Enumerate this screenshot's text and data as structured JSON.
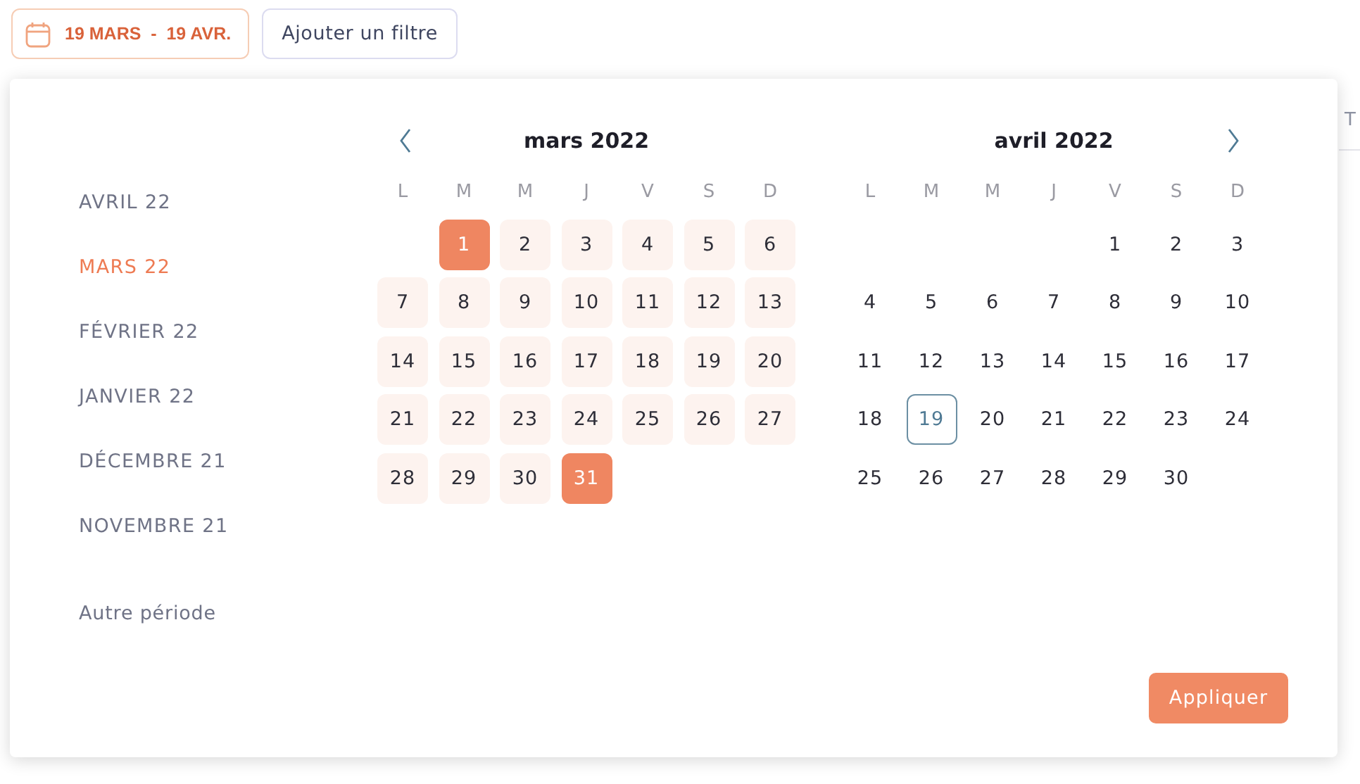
{
  "date_button": {
    "label": "19 MARS  -  19 AVR."
  },
  "filter_button": {
    "label": "Ajouter un filtre"
  },
  "background_text": "T",
  "sidebar": {
    "items": [
      {
        "label": "AVRIL 22",
        "selected": false
      },
      {
        "label": "MARS 22",
        "selected": true
      },
      {
        "label": "FÉVRIER 22",
        "selected": false
      },
      {
        "label": "JANVIER 22",
        "selected": false
      },
      {
        "label": "DÉCEMBRE 21",
        "selected": false
      },
      {
        "label": "NOVEMBRE 21",
        "selected": false
      }
    ],
    "other": "Autre période"
  },
  "calendars": [
    {
      "title": "mars 2022",
      "weekdays": [
        "L",
        "M",
        "M",
        "J",
        "V",
        "S",
        "D"
      ],
      "weeks": [
        [
          {
            "kind": "blank"
          },
          {
            "kind": "day",
            "label": "1",
            "selected": true,
            "today": false
          },
          {
            "kind": "day",
            "label": "2",
            "selected": false,
            "in_range": true,
            "today": false
          },
          {
            "kind": "day",
            "label": "3",
            "selected": false,
            "in_range": true,
            "today": false
          },
          {
            "kind": "day",
            "label": "4",
            "selected": false,
            "in_range": true,
            "today": false
          },
          {
            "kind": "day",
            "label": "5",
            "selected": false,
            "in_range": true,
            "today": false
          },
          {
            "kind": "day",
            "label": "6",
            "selected": false,
            "in_range": true,
            "today": false
          }
        ],
        [
          {
            "kind": "day",
            "label": "7",
            "selected": false,
            "in_range": true,
            "today": false
          },
          {
            "kind": "day",
            "label": "8",
            "selected": false,
            "in_range": true,
            "today": false
          },
          {
            "kind": "day",
            "label": "9",
            "selected": false,
            "in_range": true,
            "today": false
          },
          {
            "kind": "day",
            "label": "10",
            "selected": false,
            "in_range": true,
            "today": false
          },
          {
            "kind": "day",
            "label": "11",
            "selected": false,
            "in_range": true,
            "today": false
          },
          {
            "kind": "day",
            "label": "12",
            "selected": false,
            "in_range": true,
            "today": false
          },
          {
            "kind": "day",
            "label": "13",
            "selected": false,
            "in_range": true,
            "today": false
          }
        ],
        [
          {
            "kind": "day",
            "label": "14",
            "selected": false,
            "in_range": true,
            "today": false
          },
          {
            "kind": "day",
            "label": "15",
            "selected": false,
            "in_range": true,
            "today": false
          },
          {
            "kind": "day",
            "label": "16",
            "selected": false,
            "in_range": true,
            "today": false
          },
          {
            "kind": "day",
            "label": "17",
            "selected": false,
            "in_range": true,
            "today": false
          },
          {
            "kind": "day",
            "label": "18",
            "selected": false,
            "in_range": true,
            "today": false
          },
          {
            "kind": "day",
            "label": "19",
            "selected": false,
            "in_range": true,
            "today": false
          },
          {
            "kind": "day",
            "label": "20",
            "selected": false,
            "in_range": true,
            "today": false
          }
        ],
        [
          {
            "kind": "day",
            "label": "21",
            "selected": false,
            "in_range": true,
            "today": false
          },
          {
            "kind": "day",
            "label": "22",
            "selected": false,
            "in_range": true,
            "today": false
          },
          {
            "kind": "day",
            "label": "23",
            "selected": false,
            "in_range": true,
            "today": false
          },
          {
            "kind": "day",
            "label": "24",
            "selected": false,
            "in_range": true,
            "today": false
          },
          {
            "kind": "day",
            "label": "25",
            "selected": false,
            "in_range": true,
            "today": false
          },
          {
            "kind": "day",
            "label": "26",
            "selected": false,
            "in_range": true,
            "today": false
          },
          {
            "kind": "day",
            "label": "27",
            "selected": false,
            "in_range": true,
            "today": false
          }
        ],
        [
          {
            "kind": "day",
            "label": "28",
            "selected": false,
            "in_range": true,
            "today": false
          },
          {
            "kind": "day",
            "label": "29",
            "selected": false,
            "in_range": true,
            "today": false
          },
          {
            "kind": "day",
            "label": "30",
            "selected": false,
            "in_range": true,
            "today": false
          },
          {
            "kind": "day",
            "label": "31",
            "selected": true,
            "today": false
          }
        ]
      ]
    },
    {
      "title": "avril 2022",
      "weekdays": [
        "L",
        "M",
        "M",
        "J",
        "V",
        "S",
        "D"
      ],
      "weeks": [
        [
          {
            "kind": "blank"
          },
          {
            "kind": "blank"
          },
          {
            "kind": "blank"
          },
          {
            "kind": "blank"
          },
          {
            "kind": "day",
            "label": "1",
            "selected": false,
            "in_range": false,
            "today": false
          },
          {
            "kind": "day",
            "label": "2",
            "selected": false,
            "in_range": false,
            "today": false
          },
          {
            "kind": "day",
            "label": "3",
            "selected": false,
            "in_range": false,
            "today": false
          }
        ],
        [
          {
            "kind": "day",
            "label": "4",
            "selected": false,
            "in_range": false,
            "today": false
          },
          {
            "kind": "day",
            "label": "5",
            "selected": false,
            "in_range": false,
            "today": false
          },
          {
            "kind": "day",
            "label": "6",
            "selected": false,
            "in_range": false,
            "today": false
          },
          {
            "kind": "day",
            "label": "7",
            "selected": false,
            "in_range": false,
            "today": false
          },
          {
            "kind": "day",
            "label": "8",
            "selected": false,
            "in_range": false,
            "today": false
          },
          {
            "kind": "day",
            "label": "9",
            "selected": false,
            "in_range": false,
            "today": false
          },
          {
            "kind": "day",
            "label": "10",
            "selected": false,
            "in_range": false,
            "today": false
          }
        ],
        [
          {
            "kind": "day",
            "label": "11",
            "selected": false,
            "in_range": false,
            "today": false
          },
          {
            "kind": "day",
            "label": "12",
            "selected": false,
            "in_range": false,
            "today": false
          },
          {
            "kind": "day",
            "label": "13",
            "selected": false,
            "in_range": false,
            "today": false
          },
          {
            "kind": "day",
            "label": "14",
            "selected": false,
            "in_range": false,
            "today": false
          },
          {
            "kind": "day",
            "label": "15",
            "selected": false,
            "in_range": false,
            "today": false
          },
          {
            "kind": "day",
            "label": "16",
            "selected": false,
            "in_range": false,
            "today": false
          },
          {
            "kind": "day",
            "label": "17",
            "selected": false,
            "in_range": false,
            "today": false
          }
        ],
        [
          {
            "kind": "day",
            "label": "18",
            "selected": false,
            "in_range": false,
            "today": false
          },
          {
            "kind": "day",
            "label": "19",
            "selected": false,
            "in_range": false,
            "today": true
          },
          {
            "kind": "day",
            "label": "20",
            "selected": false,
            "in_range": false,
            "today": false
          },
          {
            "kind": "day",
            "label": "21",
            "selected": false,
            "in_range": false,
            "today": false
          },
          {
            "kind": "day",
            "label": "22",
            "selected": false,
            "in_range": false,
            "today": false
          },
          {
            "kind": "day",
            "label": "23",
            "selected": false,
            "in_range": false,
            "today": false
          },
          {
            "kind": "day",
            "label": "24",
            "selected": false,
            "in_range": false,
            "today": false
          }
        ],
        [
          {
            "kind": "day",
            "label": "25",
            "selected": false,
            "in_range": false,
            "today": false
          },
          {
            "kind": "day",
            "label": "26",
            "selected": false,
            "in_range": false,
            "today": false
          },
          {
            "kind": "day",
            "label": "27",
            "selected": false,
            "in_range": false,
            "today": false
          },
          {
            "kind": "day",
            "label": "28",
            "selected": false,
            "in_range": false,
            "today": false
          },
          {
            "kind": "day",
            "label": "29",
            "selected": false,
            "in_range": false,
            "today": false
          },
          {
            "kind": "day",
            "label": "30",
            "selected": false,
            "in_range": false,
            "today": false
          }
        ]
      ]
    }
  ],
  "apply_button": {
    "label": "Appliquer"
  }
}
